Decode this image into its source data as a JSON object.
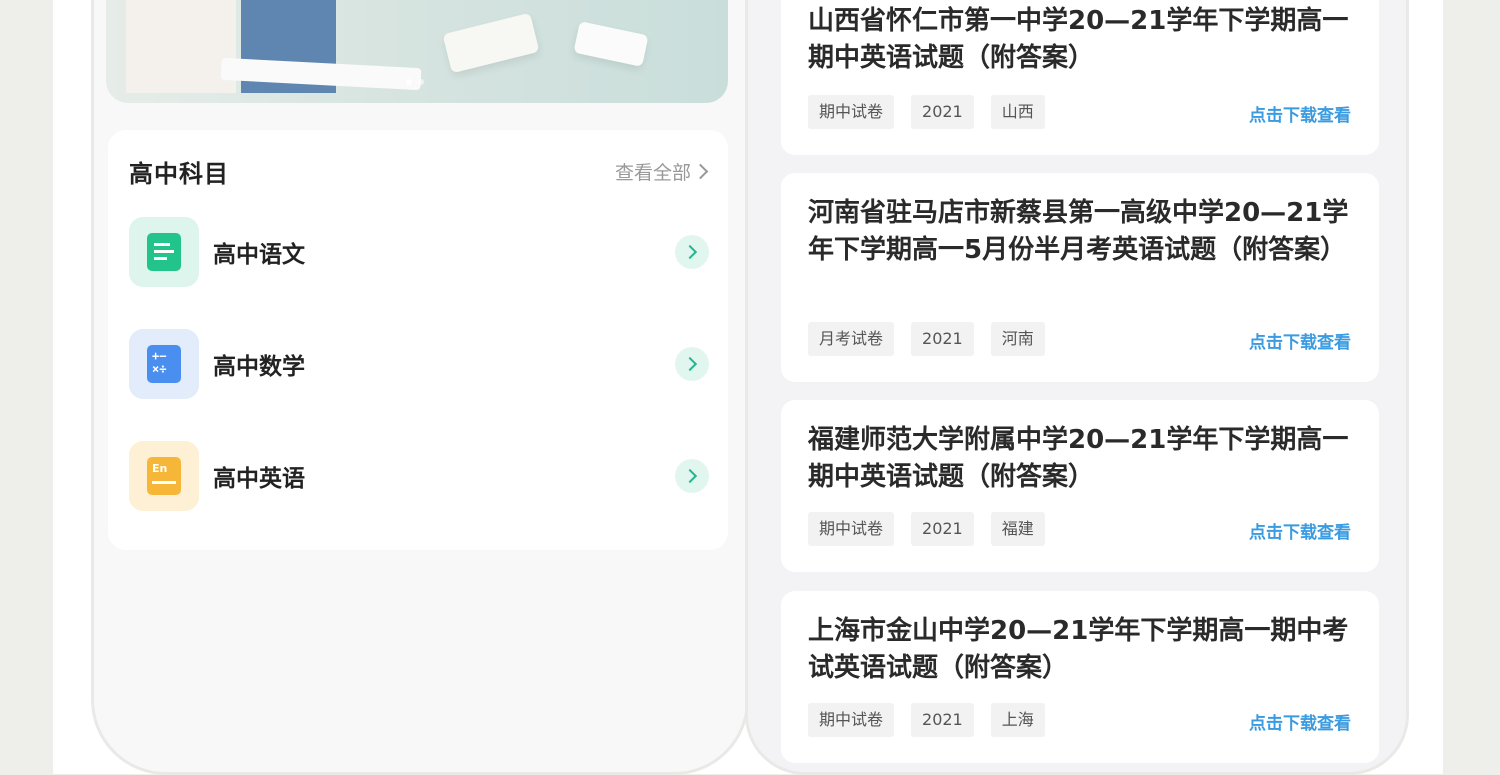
{
  "subjects_section": {
    "title": "高中科目",
    "view_all": "查看全部",
    "items": [
      {
        "label": "高中语文",
        "icon": "document-icon",
        "bg": "#ddf5ec",
        "color": "#22c48c"
      },
      {
        "label": "高中数学",
        "icon": "calculator-icon",
        "bg": "#e2ecfb",
        "color": "#4a8ff0"
      },
      {
        "label": "高中英语",
        "icon": "english-book-icon",
        "bg": "#fdf0d4",
        "color": "#f6b738"
      }
    ]
  },
  "papers": [
    {
      "title": "山西省怀仁市第一中学20—21学年下学期高一期中英语试题（附答案）",
      "tags": [
        "期中试卷",
        "2021",
        "山西"
      ],
      "link": "点击下载查看"
    },
    {
      "title": "河南省驻马店市新蔡县第一高级中学20—21学年下学期高一5月份半月考英语试题（附答案）",
      "tags": [
        "月考试卷",
        "2021",
        "河南"
      ],
      "link": "点击下载查看"
    },
    {
      "title": "福建师范大学附属中学20—21学年下学期高一期中英语试题（附答案）",
      "tags": [
        "期中试卷",
        "2021",
        "福建"
      ],
      "link": "点击下载查看"
    },
    {
      "title": "上海市金山中学20—21学年下学期高一期中考试英语试题（附答案）",
      "tags": [
        "期中试卷",
        "2021",
        "上海"
      ],
      "link": "点击下载查看"
    }
  ]
}
